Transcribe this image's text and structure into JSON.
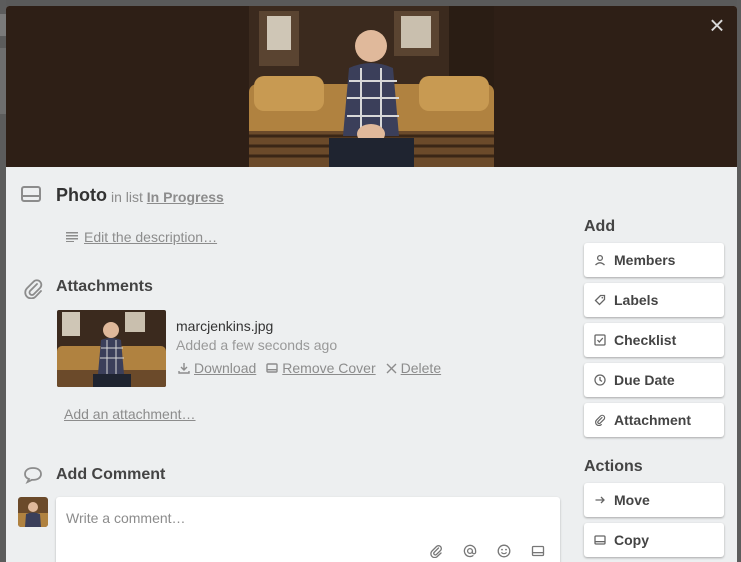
{
  "modal": {
    "close_label": "×"
  },
  "card": {
    "title": "Photo",
    "in_list_prefix": "in list",
    "list_name": "In Progress",
    "description_link": "Edit the description…"
  },
  "attachments": {
    "heading": "Attachments",
    "items": [
      {
        "file_name": "marcjenkins.jpg",
        "added": "Added a few seconds ago",
        "download_label": "Download",
        "remove_cover_label": "Remove Cover",
        "delete_label": "Delete"
      }
    ],
    "add_link": "Add an attachment…"
  },
  "comment": {
    "heading": "Add Comment",
    "placeholder": "Write a comment…",
    "tools": [
      "attachment-icon",
      "mention-icon",
      "emoji-icon",
      "card-icon"
    ]
  },
  "sidebar": {
    "add_heading": "Add",
    "add_buttons": [
      {
        "label": "Members",
        "icon": "person-icon"
      },
      {
        "label": "Labels",
        "icon": "tag-icon"
      },
      {
        "label": "Checklist",
        "icon": "checkbox-icon"
      },
      {
        "label": "Due Date",
        "icon": "clock-icon"
      },
      {
        "label": "Attachment",
        "icon": "paperclip-icon"
      }
    ],
    "actions_heading": "Actions",
    "action_buttons": [
      {
        "label": "Move",
        "icon": "arrow-right-icon"
      },
      {
        "label": "Copy",
        "icon": "card-icon"
      }
    ]
  },
  "colors": {
    "cover_background": "#2e1f16",
    "modal_background": "#edeff0",
    "muted_text": "#8c8c8c"
  }
}
